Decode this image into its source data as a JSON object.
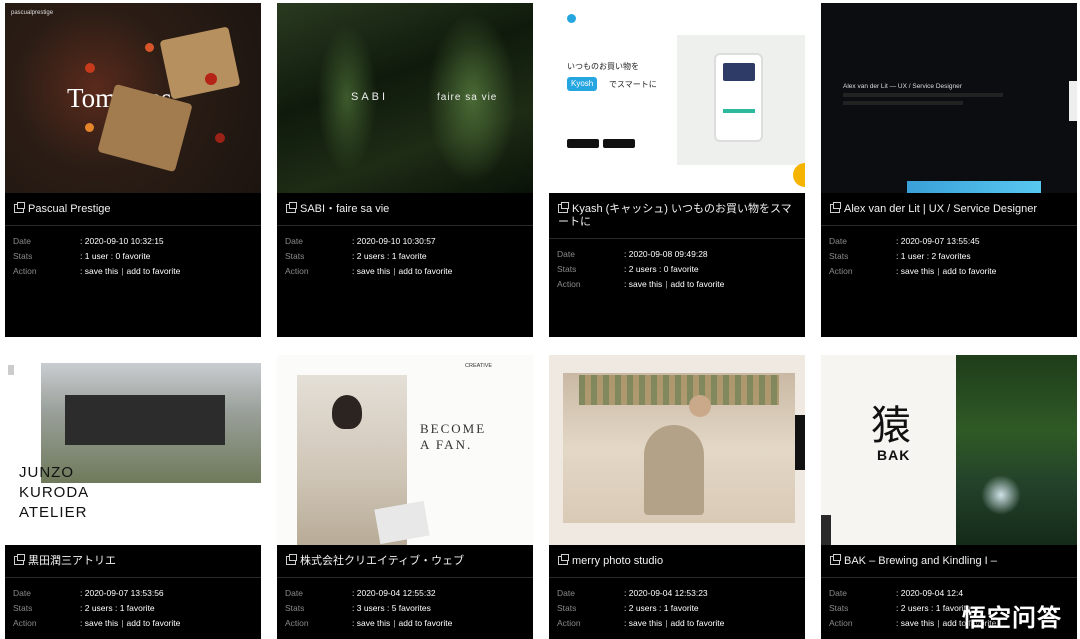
{
  "cards": [
    {
      "title": "Pascual Prestige",
      "date": "2020-09-10 10:32:15",
      "stats": "1 user : 0 favorite",
      "hero": "Tomatoes",
      "brand": "pascualprestige"
    },
    {
      "title": "SABI・faire sa vie",
      "date": "2020-09-10 10:30:57",
      "stats": "2 users : 1 favorite",
      "hero_left": "SABI",
      "hero_right": "faire sa vie"
    },
    {
      "title": "Kyash (キャッシュ) いつものお買い物をスマートに",
      "date": "2020-09-08 09:49:28",
      "stats": "2 users : 0 favorite",
      "hero_line1": "いつものお買い物を",
      "hero_line2": "でスマートに",
      "brand": "Kyosh"
    },
    {
      "title": "Alex van der Lit | UX / Service Designer",
      "date": "2020-09-07 13:55:45",
      "stats": "1 user : 2 favorites",
      "hero": "Alex van der Lit — UX / Service Designer"
    },
    {
      "title": "黒田潤三アトリエ",
      "date": "2020-09-07 13:53:56",
      "stats": "2 users : 1 favorite",
      "hero_lines": [
        "JUNZO",
        "KURODA",
        "ATELIER"
      ]
    },
    {
      "title": "株式会社クリエイティブ・ウェブ",
      "date": "2020-09-04 12:55:32",
      "stats": "3 users : 5 favorites",
      "hero_line1": "BECOME",
      "hero_line2": "A FAN.",
      "brand": "CREATIVE"
    },
    {
      "title": "merry photo studio",
      "date": "2020-09-04 12:53:23",
      "stats": "2 users : 1 favorite"
    },
    {
      "title": "BAK – Brewing and Kindling I –",
      "date": "2020-09-04 12:4",
      "stats": "2 users : 1 favorite",
      "hero_kanji": "猿",
      "hero": "BAK"
    }
  ],
  "labels": {
    "date": "Date",
    "stats": "Stats",
    "action": "Action"
  },
  "actions": {
    "save": "save this",
    "favorite": "add to favorite"
  },
  "watermark": "悟空问答"
}
